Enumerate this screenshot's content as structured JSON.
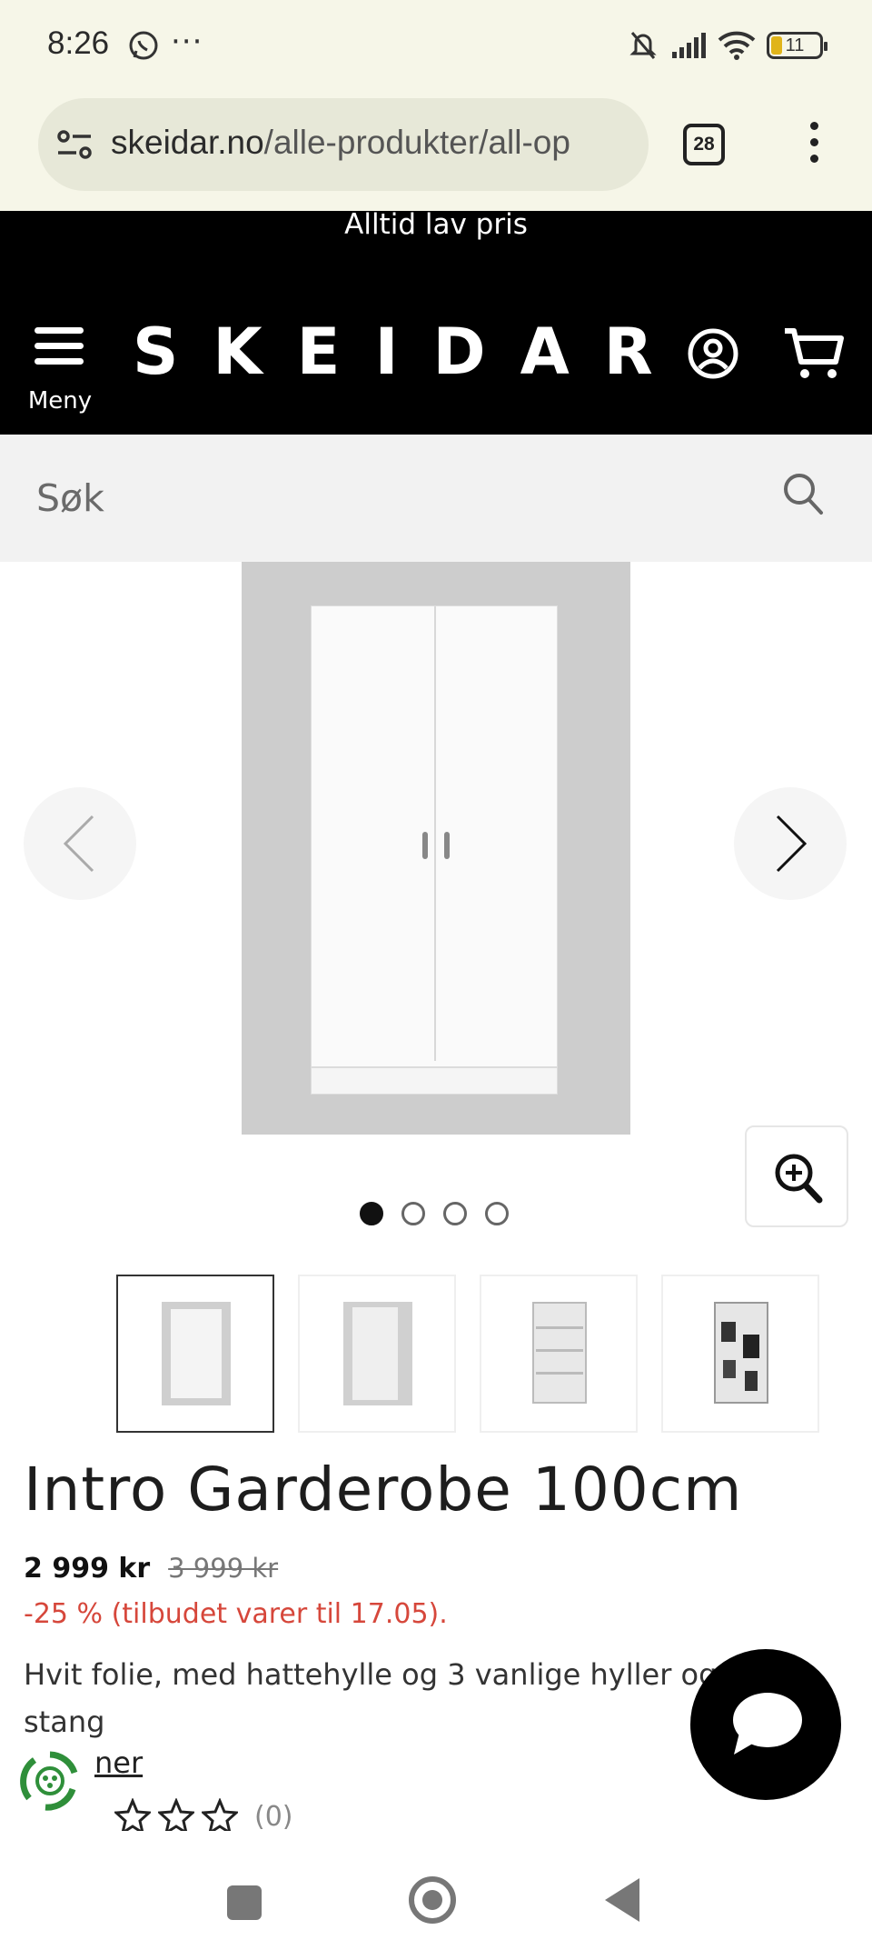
{
  "status_bar": {
    "time": "8:26",
    "dots": "···",
    "battery": "11"
  },
  "browser": {
    "url_host": "skeidar.no",
    "url_path": "/alle-produkter/all-op",
    "tab_count": "28"
  },
  "site": {
    "promo": "Alltid lav pris",
    "logo": "SKEIDAR",
    "menu_label": "Meny"
  },
  "search": {
    "placeholder": "Søk"
  },
  "product": {
    "title": "Intro Garderobe 100cm",
    "price": "2 999 kr",
    "old_price": "3 999 kr",
    "discount": "-25 % (tilbudet varer til 17.05).",
    "description": "Hvit folie, med hattehylle og 3 vanlige hyller og stang",
    "more_link": "ner",
    "rating_stars": 0,
    "rating_count": "(0)"
  },
  "gallery": {
    "image_count": 4,
    "active_index": 0
  },
  "colors": {
    "header_bg": "#000000",
    "discount": "#d6473b",
    "status_bg": "#f6f6e8",
    "battery": "#e0b41a"
  },
  "icons": [
    "whatsapp-icon",
    "mute-icon",
    "signal-icon",
    "wifi-icon",
    "battery-icon",
    "site-settings-icon",
    "tabs-icon",
    "more-icon",
    "menu-icon",
    "user-icon",
    "cart-icon",
    "search-icon",
    "chevron-left-icon",
    "chevron-right-icon",
    "zoom-in-icon",
    "chat-icon",
    "eco-badge-icon",
    "star-icon"
  ]
}
